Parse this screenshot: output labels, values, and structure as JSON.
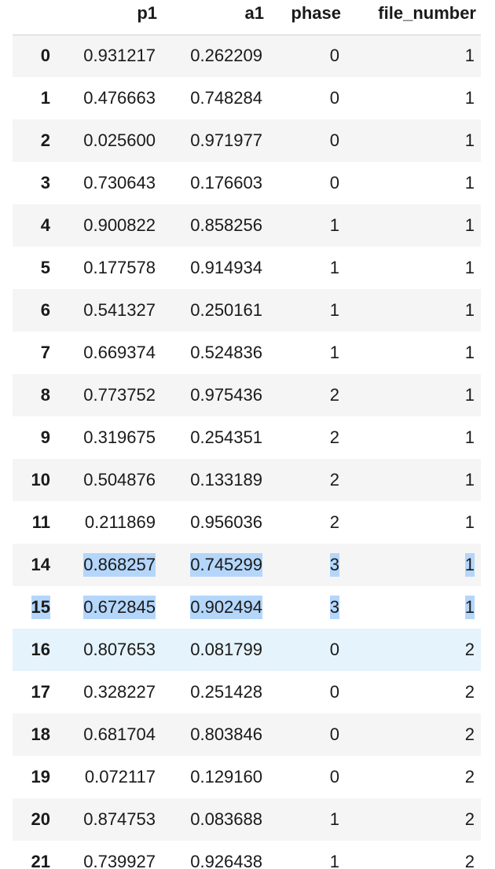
{
  "table": {
    "columns": [
      "p1",
      "a1",
      "phase",
      "file_number"
    ],
    "rows": [
      {
        "index": "0",
        "p1": "0.931217",
        "a1": "0.262209",
        "phase": "0",
        "file_number": "1"
      },
      {
        "index": "1",
        "p1": "0.476663",
        "a1": "0.748284",
        "phase": "0",
        "file_number": "1"
      },
      {
        "index": "2",
        "p1": "0.025600",
        "a1": "0.971977",
        "phase": "0",
        "file_number": "1"
      },
      {
        "index": "3",
        "p1": "0.730643",
        "a1": "0.176603",
        "phase": "0",
        "file_number": "1"
      },
      {
        "index": "4",
        "p1": "0.900822",
        "a1": "0.858256",
        "phase": "1",
        "file_number": "1"
      },
      {
        "index": "5",
        "p1": "0.177578",
        "a1": "0.914934",
        "phase": "1",
        "file_number": "1"
      },
      {
        "index": "6",
        "p1": "0.541327",
        "a1": "0.250161",
        "phase": "1",
        "file_number": "1"
      },
      {
        "index": "7",
        "p1": "0.669374",
        "a1": "0.524836",
        "phase": "1",
        "file_number": "1"
      },
      {
        "index": "8",
        "p1": "0.773752",
        "a1": "0.975436",
        "phase": "2",
        "file_number": "1"
      },
      {
        "index": "9",
        "p1": "0.319675",
        "a1": "0.254351",
        "phase": "2",
        "file_number": "1"
      },
      {
        "index": "10",
        "p1": "0.504876",
        "a1": "0.133189",
        "phase": "2",
        "file_number": "1"
      },
      {
        "index": "11",
        "p1": "0.211869",
        "a1": "0.956036",
        "phase": "2",
        "file_number": "1"
      },
      {
        "index": "14",
        "p1": "0.868257",
        "a1": "0.745299",
        "phase": "3",
        "file_number": "1"
      },
      {
        "index": "15",
        "p1": "0.672845",
        "a1": "0.902494",
        "phase": "3",
        "file_number": "1"
      },
      {
        "index": "16",
        "p1": "0.807653",
        "a1": "0.081799",
        "phase": "0",
        "file_number": "2"
      },
      {
        "index": "17",
        "p1": "0.328227",
        "a1": "0.251428",
        "phase": "0",
        "file_number": "2"
      },
      {
        "index": "18",
        "p1": "0.681704",
        "a1": "0.803846",
        "phase": "0",
        "file_number": "2"
      },
      {
        "index": "19",
        "p1": "0.072117",
        "a1": "0.129160",
        "phase": "0",
        "file_number": "2"
      },
      {
        "index": "20",
        "p1": "0.874753",
        "a1": "0.083688",
        "phase": "1",
        "file_number": "2"
      },
      {
        "index": "21",
        "p1": "0.739927",
        "a1": "0.926438",
        "phase": "1",
        "file_number": "2"
      }
    ]
  },
  "colors": {
    "selection": "#b4d6fa",
    "hover_row": "#e5f3fc",
    "stripe": "#f5f5f5"
  }
}
